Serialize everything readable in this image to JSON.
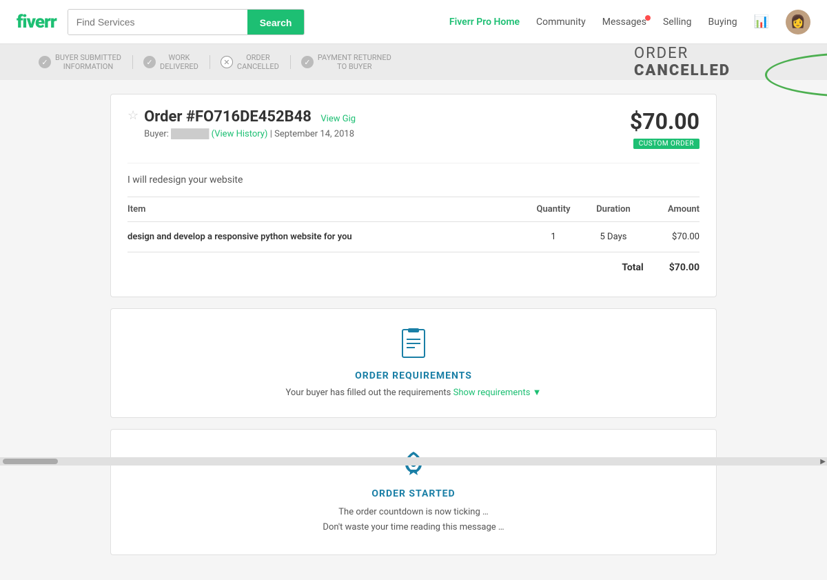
{
  "header": {
    "logo": "fiverr",
    "search_placeholder": "Find Services",
    "search_button": "Search",
    "nav": {
      "pro_home": "Fiverr Pro Home",
      "community": "Community",
      "messages": "Messages",
      "selling": "Selling",
      "buying": "Buying"
    }
  },
  "progress": {
    "steps": [
      {
        "id": "buyer-submitted",
        "label": "BUYER SUBMITTED\nINFORMATION",
        "icon": "check",
        "active": true
      },
      {
        "id": "work-delivered",
        "label": "WORK\nDELIVERED",
        "icon": "check",
        "active": true
      },
      {
        "id": "order-cancelled",
        "label": "ORDER\nCANCELLED",
        "icon": "cross",
        "active": false
      },
      {
        "id": "payment-returned",
        "label": "PAYMENT RETURNED\nTO BUYER",
        "icon": "check",
        "active": true
      }
    ],
    "cancelled_label_1": "ORDER",
    "cancelled_label_2": "CANCELLED"
  },
  "order": {
    "id": "Order #FO716DE452B48",
    "view_gig": "View Gig",
    "buyer_label": "Buyer:",
    "buyer_name": "██████",
    "view_history": "(View History)",
    "date": "September 14, 2018",
    "price": "$70.00",
    "custom_badge": "CUSTOM ORDER",
    "description": "I will redesign your website",
    "table": {
      "headers": [
        "Item",
        "Quantity",
        "Duration",
        "Amount"
      ],
      "rows": [
        {
          "item": "design and develop a responsive python website for you",
          "quantity": "1",
          "duration": "5 Days",
          "amount": "$70.00"
        }
      ],
      "total_label": "Total",
      "total_value": "$70.00"
    }
  },
  "requirements": {
    "icon": "📋",
    "title": "ORDER REQUIREMENTS",
    "text": "Your buyer has filled out the requirements",
    "show_link": "Show requirements ▼"
  },
  "order_started": {
    "icon": "🚀",
    "title": "ORDER STARTED",
    "line1": "The order countdown is now ticking …",
    "line2": "Don't waste your time reading this message …"
  }
}
